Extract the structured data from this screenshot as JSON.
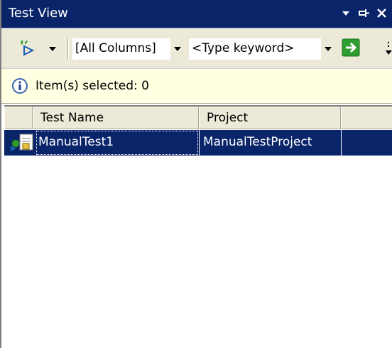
{
  "window": {
    "title": "Test View",
    "controls": {
      "dropdown": "▾",
      "pin": "⊣",
      "close": "✕"
    }
  },
  "toolbar": {
    "column_filter": "[All Columns]",
    "keyword_filter": "<Type keyword>",
    "icons": [
      "run-tests-icon",
      "dropdown-arrow-icon",
      "go-arrow-icon"
    ]
  },
  "infobar": {
    "text": "Item(s) selected: 0",
    "icon": "info-icon"
  },
  "grid": {
    "columns": [
      "Test Name",
      "Project",
      ""
    ],
    "rows": [
      {
        "test_name": "ManualTest1",
        "project": "ManualTestProject",
        "icon": "manual-test-icon",
        "selected": true
      }
    ]
  },
  "colors": {
    "title_bar": "#0a246a",
    "toolbar": "#ece9d8",
    "infobar": "#ffffe1",
    "selection": "#0a246a",
    "go_button": "#2e9e2e"
  }
}
